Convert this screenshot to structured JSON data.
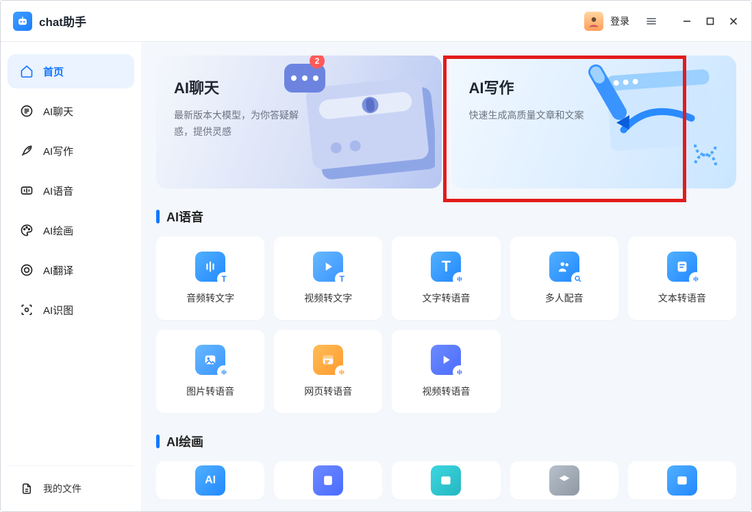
{
  "app": {
    "title": "chat助手"
  },
  "titlebar": {
    "login": "登录"
  },
  "sidebar": {
    "items": [
      {
        "id": "home",
        "label": "首页"
      },
      {
        "id": "chat",
        "label": "AI聊天"
      },
      {
        "id": "write",
        "label": "AI写作"
      },
      {
        "id": "voice",
        "label": "AI语音"
      },
      {
        "id": "paint",
        "label": "AI绘画"
      },
      {
        "id": "trans",
        "label": "AI翻译"
      },
      {
        "id": "vision",
        "label": "AI识图"
      }
    ],
    "active": "home",
    "footer": {
      "myfiles": "我的文件"
    }
  },
  "hero": {
    "chat": {
      "title": "AI聊天",
      "subtitle": "最新版本大模型，为你答疑解惑，提供灵感",
      "badge": "2"
    },
    "write": {
      "title": "AI写作",
      "subtitle": "快速生成高质量文章和文案"
    }
  },
  "sections": {
    "voice": {
      "title": "AI语音",
      "features": [
        {
          "id": "audio2text",
          "label": "音频转文字"
        },
        {
          "id": "video2text",
          "label": "视频转文字"
        },
        {
          "id": "text2speech",
          "label": "文字转语音"
        },
        {
          "id": "multidub",
          "label": "多人配音"
        },
        {
          "id": "doc2speech",
          "label": "文本转语音"
        },
        {
          "id": "image2speech",
          "label": "图片转语音"
        },
        {
          "id": "web2speech",
          "label": "网页转语音"
        },
        {
          "id": "video2speech",
          "label": "视频转语音"
        }
      ]
    },
    "paint": {
      "title": "AI绘画"
    }
  }
}
